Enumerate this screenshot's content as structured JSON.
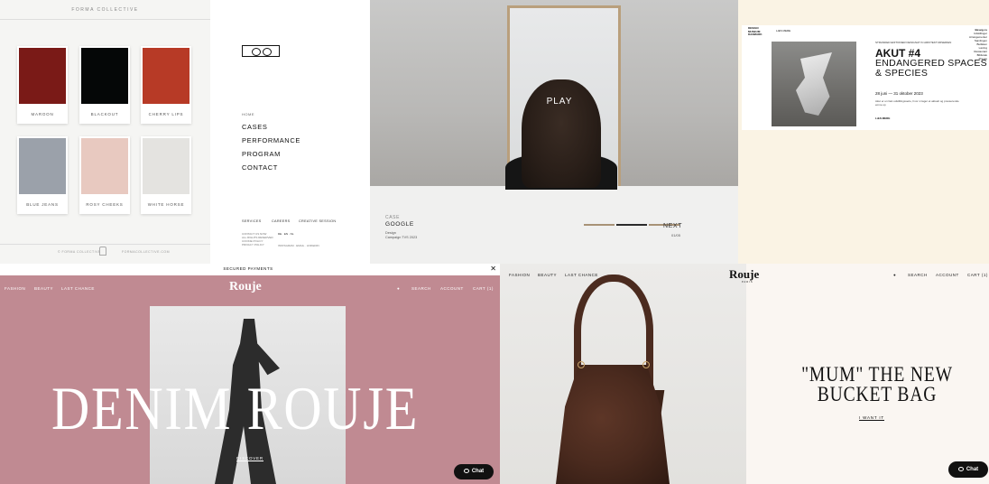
{
  "palette_panel": {
    "brand": "FORMA COLLECTIVE",
    "swatches": [
      {
        "name": "MAROON",
        "color": "#7a1a17"
      },
      {
        "name": "BLACKOUT",
        "color": "#050707"
      },
      {
        "name": "CHERRY LIPS",
        "color": "#b73a26"
      },
      {
        "name": "BLUE JEANS",
        "color": "#9ba1aa"
      },
      {
        "name": "ROSY CHEEKS",
        "color": "#e8c9c0"
      },
      {
        "name": "WHITE HORSE",
        "color": "#e4e3e0"
      }
    ],
    "footer_left": "© FORMA COLLECTIVE",
    "footer_right": "FORMACOLLECTIVE.COM"
  },
  "agency_panel": {
    "home": "HOME",
    "menu": [
      "CASES",
      "PERFORMANCE",
      "PROGRAM",
      "CONTACT"
    ],
    "bottom_links": [
      "SERVICES",
      "CAREERS",
      "CREATIVE SESSION"
    ],
    "contact_lines": [
      "CONTACT US NOW",
      "ALL RIGHTS RESERVED",
      "COOKIE POLICY",
      "PRIVACY POLICY"
    ],
    "langs": "DE · EN · NL",
    "social": "INSTAGRAM · EMAIL · LINKEDIN"
  },
  "video_panel": {
    "play": "PLAY",
    "case_label": "CASE",
    "client": "GOOGLE",
    "desc_line1": "Design",
    "desc_line2": "Campaign TVS 2023",
    "next": "NEXT",
    "counter": "01/05",
    "bar_colors": [
      "#a89276",
      "#2b2b2b",
      "#a89276"
    ]
  },
  "exhibition_panel": {
    "logo_lines": [
      "DESIGN",
      "MUSEUM",
      "DANMARK"
    ],
    "nav": "LÆS MERE",
    "pre": "STRANDED EDITIONER DESIGNAT IN ARKITEKTURSERIEN",
    "title1": "AKUT #4",
    "title2": "ENDANGERED SPACES & SPECIES",
    "dates": "28 juni  —  31 oktober 2023",
    "excerpt": "Akut er en fast udstillingsserie, hvor vi tager et aktuelt og presserende emne op",
    "more": "LÆS MERE",
    "side_items": [
      "Besøg os",
      "Udstillinger",
      "Arrangementer",
      "Samlingen",
      "Butikken",
      "Læring",
      "Restaurant",
      "Bibliotek",
      "Presse"
    ]
  },
  "rouje_denim_panel": {
    "topbar": "SECURED PAYMENTS",
    "close": "✕",
    "nav_left": [
      "FASHION",
      "BEAUTY",
      "LAST CHANCE"
    ],
    "logo": "Rouje",
    "nav_right": [
      "SEARCH",
      "ACCOUNT",
      "CART (1)"
    ],
    "headline": "DENIM ROUJE",
    "cta": "DISCOVER",
    "chat": "Chat"
  },
  "rouje_bag_panel": {
    "nav_left": [
      "FASHION",
      "BEAUTY",
      "LAST CHANCE"
    ],
    "logo": "Rouje",
    "logo_sub": "PARIS",
    "nav_right": [
      "SEARCH",
      "ACCOUNT",
      "CART (1)"
    ],
    "headline_line1": "\"MUM\" THE NEW",
    "headline_line2": "BUCKET BAG",
    "cta": "I WANT IT",
    "chat": "Chat"
  }
}
